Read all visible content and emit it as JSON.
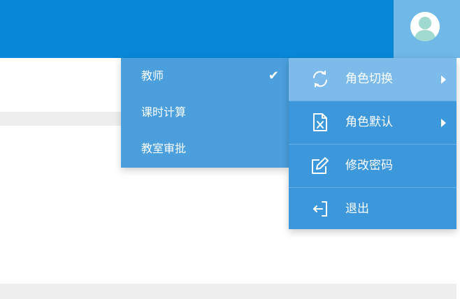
{
  "header": {
    "avatar_icon": "user-avatar-icon",
    "bg_color": "#0887d6"
  },
  "submenu": {
    "items": [
      {
        "label": "教师",
        "checked": true
      },
      {
        "label": "课时计算",
        "checked": false
      },
      {
        "label": "教室审批",
        "checked": false
      }
    ],
    "check_glyph": "✔"
  },
  "menu": {
    "items": [
      {
        "label": "角色切换",
        "icon": "refresh-icon",
        "has_submenu": true,
        "active": true
      },
      {
        "label": "角色默认",
        "icon": "excel-file-icon",
        "has_submenu": true,
        "active": false
      },
      {
        "label": "修改密码",
        "icon": "edit-icon",
        "has_submenu": false,
        "active": false
      },
      {
        "label": "退出",
        "icon": "logout-icon",
        "has_submenu": false,
        "active": false
      }
    ]
  }
}
